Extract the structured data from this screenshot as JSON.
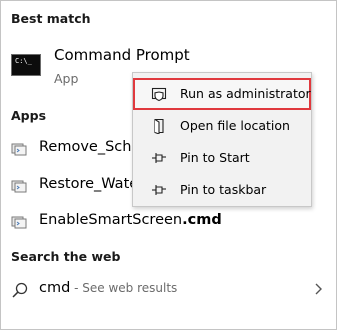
{
  "best_match": {
    "heading": "Best match",
    "app_name": "Command Prompt",
    "app_type": "App",
    "icon": "command-prompt-icon",
    "icon_glyph": "C:\\_"
  },
  "apps": {
    "heading": "Apps",
    "items": [
      {
        "name": "Remove_Sched",
        "bold_ext": "",
        "icon": "script-file-icon"
      },
      {
        "name": "Restore_Waterr",
        "bold_ext": "",
        "icon": "script-file-icon"
      },
      {
        "name": "EnableSmartScreen",
        "bold_ext": ".cmd",
        "icon": "script-file-icon"
      }
    ]
  },
  "web": {
    "heading": "Search the web",
    "query": "cmd",
    "hint": " - See web results",
    "icon": "search-icon",
    "chevron": "chevron-right-icon"
  },
  "context_menu": {
    "items": [
      {
        "label": "Run as administrator",
        "icon": "shield-icon",
        "highlighted": true
      },
      {
        "label": "Open file location",
        "icon": "open-folder-icon",
        "highlighted": false
      },
      {
        "label": "Pin to Start",
        "icon": "pin-icon",
        "highlighted": false
      },
      {
        "label": "Pin to taskbar",
        "icon": "pin-icon",
        "highlighted": false
      }
    ],
    "highlight_color": "#e0393e"
  }
}
